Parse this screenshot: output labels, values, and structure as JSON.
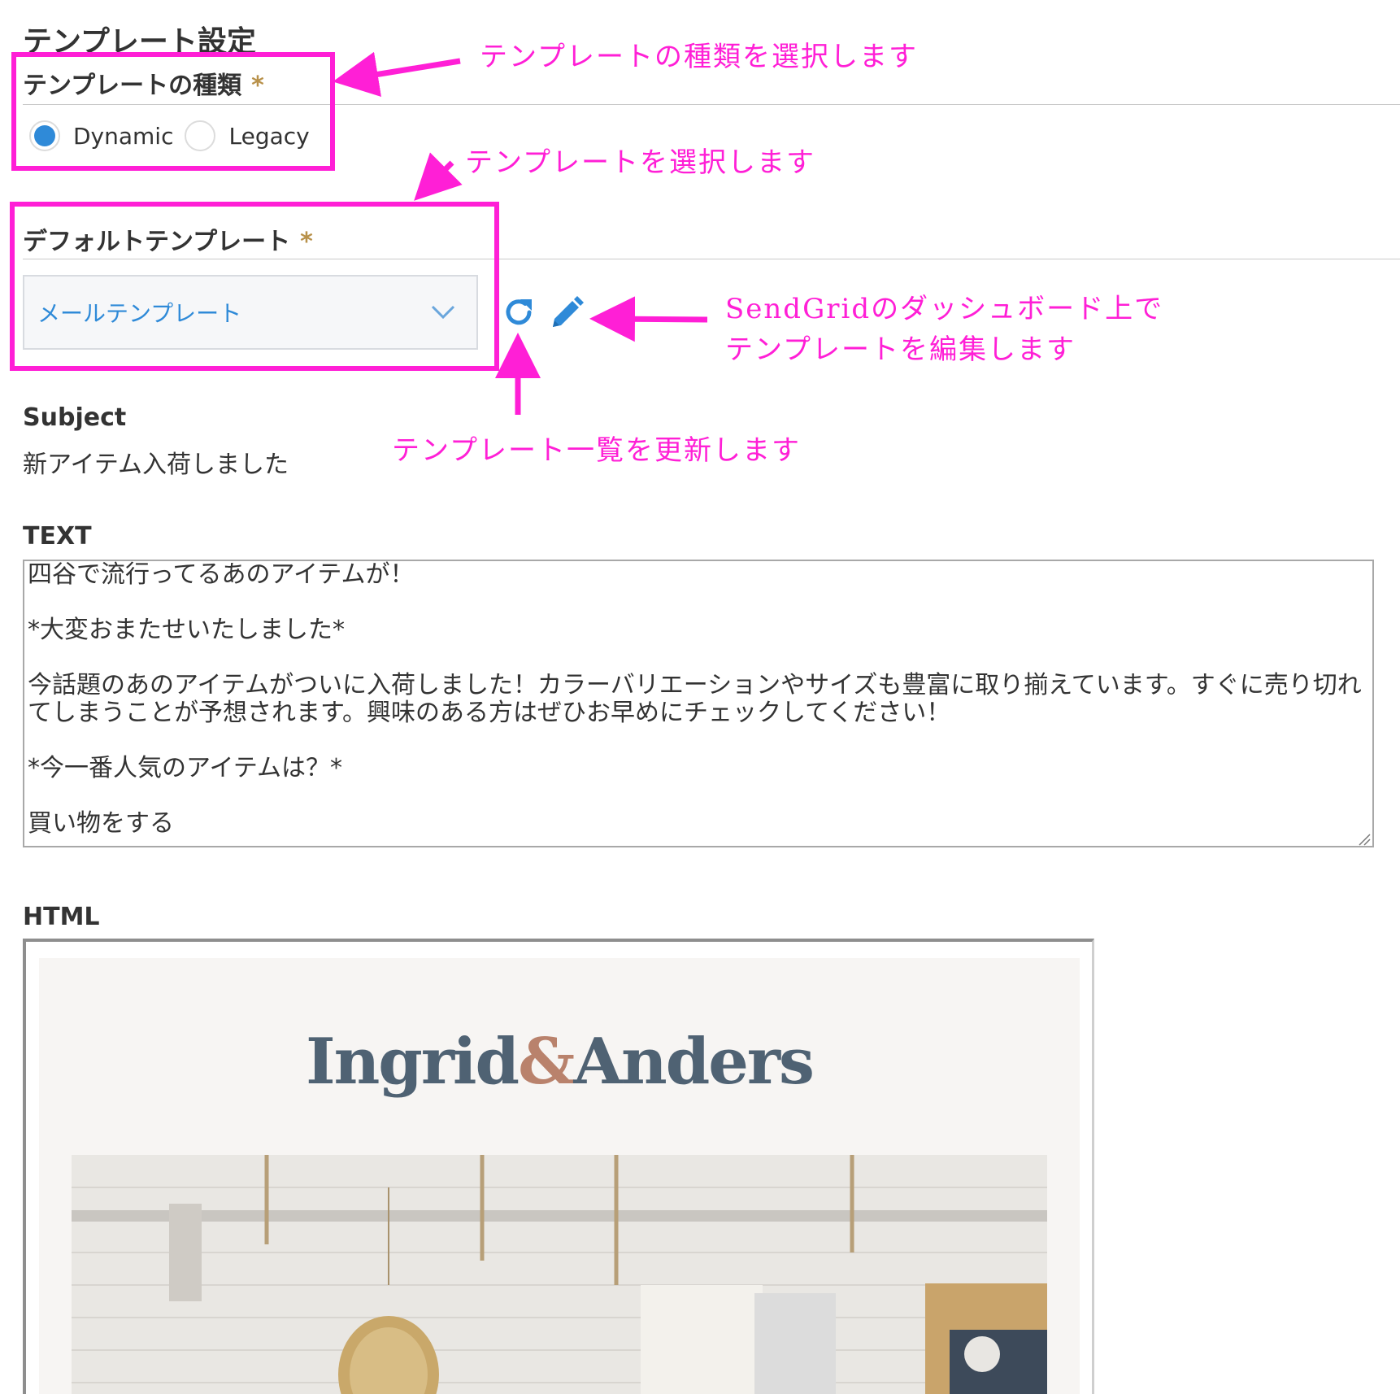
{
  "page": {
    "title": "テンプレート設定"
  },
  "template_type": {
    "label": "テンプレートの種類",
    "required_mark": "*",
    "options": [
      {
        "label": "Dynamic",
        "selected": true
      },
      {
        "label": "Legacy",
        "selected": false
      }
    ]
  },
  "default_template": {
    "label": "デフォルトテンプレート",
    "required_mark": "*",
    "selected_value": "メールテンプレート",
    "refresh_icon": "refresh-icon",
    "edit_icon": "pencil-icon"
  },
  "subject": {
    "label": "Subject",
    "value": "新アイテム入荷しました"
  },
  "text": {
    "label": "TEXT",
    "value": "四谷で流行ってるあのアイテムが！\n\n*大変おまたせいたしました*\n\n今話題のあのアイテムがついに入荷しました！カラーバリエーションやサイズも豊富に取り揃えています。すぐに売り切れてしまうことが予想されます。興味のある方はぜひお早めにチェックしてください！\n\n*今一番人気のアイテムは？*\n\n買い物をする"
  },
  "html": {
    "label": "HTML",
    "brand_part1": "Ingrid",
    "brand_amp": "&",
    "brand_part2": "Anders"
  },
  "annotations": {
    "type_select": "テンプレートの種類を選択します",
    "template_select": "テンプレートを選択します",
    "edit_line1": "SendGridのダッシュボード上で",
    "edit_line2": "テンプレートを編集します",
    "refresh": "テンプレート一覧を更新します"
  },
  "colors": {
    "annotation": "#ff1fd6",
    "accent": "#2f8ad8",
    "required": "#b8914a",
    "brand": "#4f6273",
    "brand_amp": "#b9826c"
  }
}
